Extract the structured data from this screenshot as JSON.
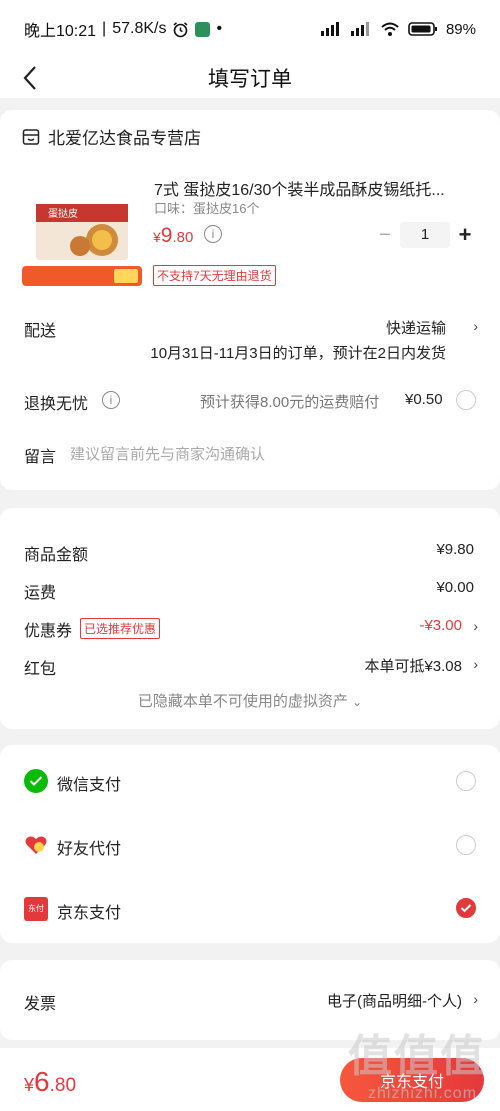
{
  "status_bar": {
    "time": "晚上10:21",
    "speed": "57.8K/s",
    "battery": "89%"
  },
  "nav": {
    "title": "填写订单"
  },
  "shop": {
    "name": "北爱亿达食品专营店"
  },
  "product": {
    "title": "7式 蛋挞皮16/30个装半成品酥皮锡纸托...",
    "flavor": "口味：蛋挞皮16个",
    "price_currency": "¥",
    "price_int": "9",
    "price_dec": ".80",
    "quantity": "1",
    "no_return_badge": "不支持7天无理由退货"
  },
  "shipping": {
    "label": "配送",
    "method": "快递运输",
    "date_note": "10月31日-11月3日的订单，预计在2日内发货"
  },
  "worry_free": {
    "label": "退换无忧",
    "text": "预计获得8.00元的运费赔付",
    "price": "¥0.50"
  },
  "note": {
    "label": "留言",
    "placeholder": "建议留言前先与商家沟通确认"
  },
  "summary": {
    "goods_label": "商品金额",
    "goods_value": "¥9.80",
    "freight_label": "运费",
    "freight_value": "¥0.00",
    "coupon_label": "优惠券",
    "coupon_tag": "已选推荐优惠",
    "coupon_value": "-¥3.00",
    "redpacket_label": "红包",
    "redpacket_value": "本单可抵¥3.08",
    "hidden_assets": "已隐藏本单不可使用的虚拟资产"
  },
  "payment": {
    "options": [
      {
        "label": "微信支付"
      },
      {
        "label": "好友代付"
      },
      {
        "label": "京东支付"
      }
    ],
    "jd_icon_text": "东付"
  },
  "invoice": {
    "label": "发票",
    "value": "电子(商品明细-个人)"
  },
  "bottom": {
    "currency": "¥",
    "total_int": "6",
    "total_dec": ".80",
    "submit": "京东支付"
  },
  "watermark": {
    "main": "值值值",
    "sub": "zhizhizhi.com"
  },
  "colors": {
    "accent": "#e4393c",
    "wechat": "#09bb07"
  }
}
